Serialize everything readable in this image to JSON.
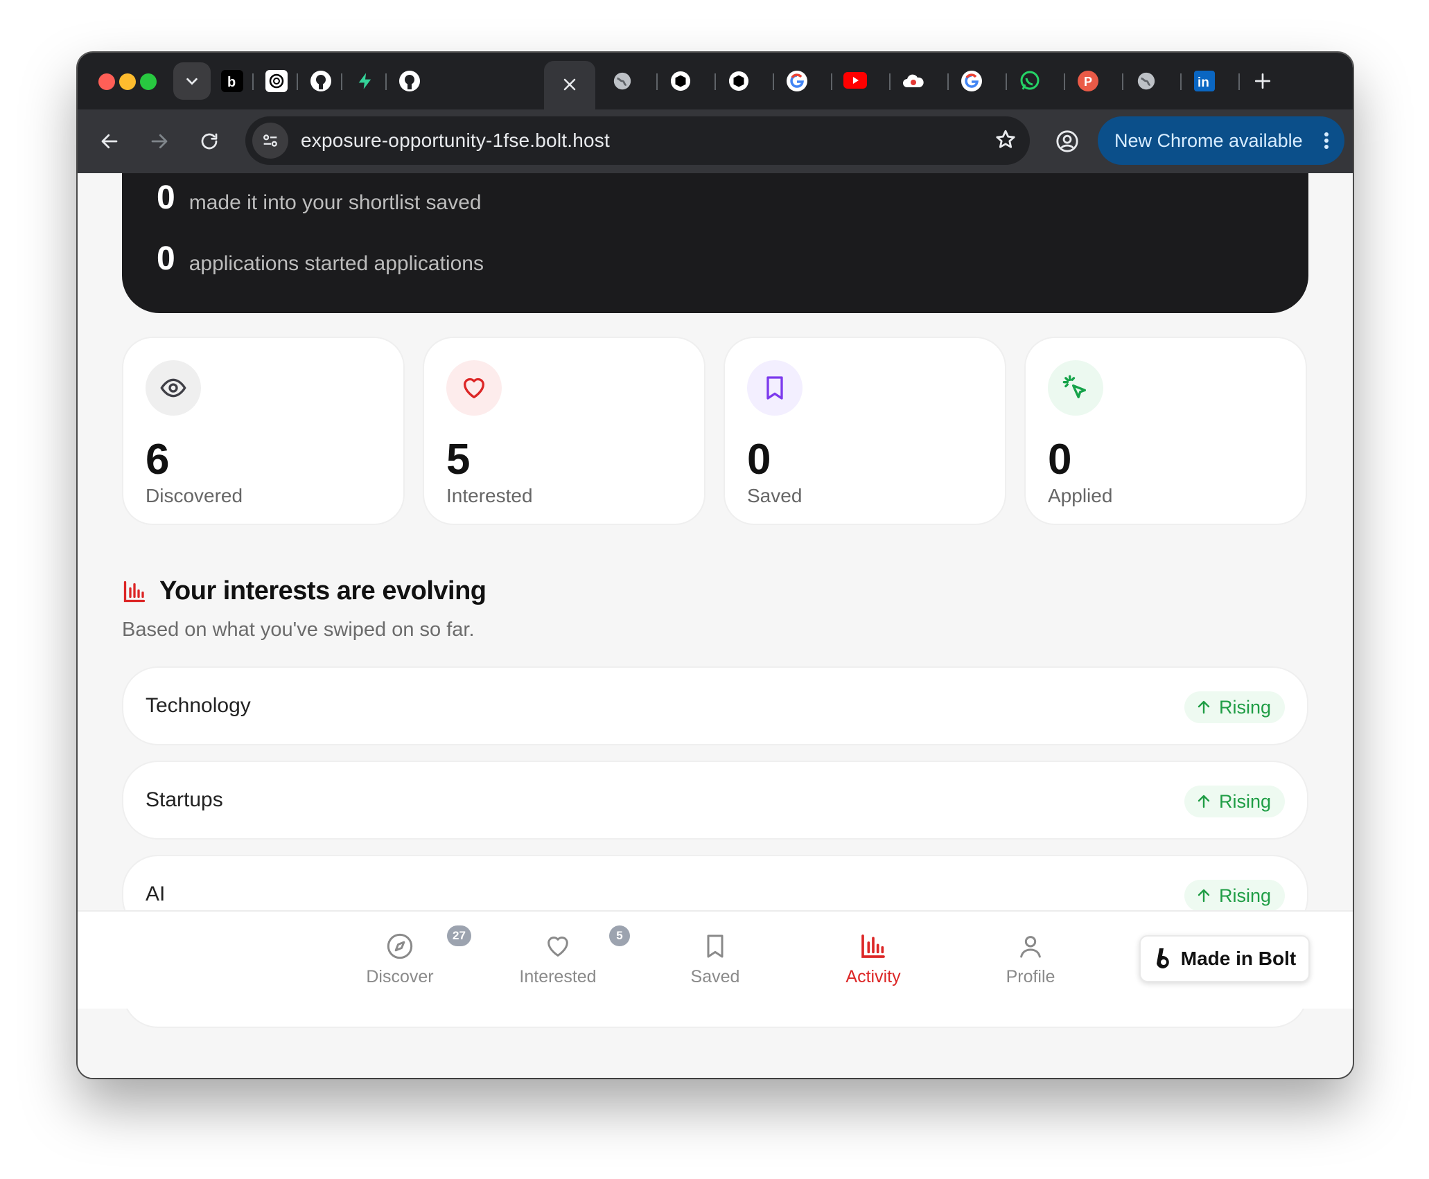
{
  "browser": {
    "url": "exposure-opportunity-1fse.bolt.host",
    "update_button": "New Chrome available",
    "tabs": [
      "bolt-icon",
      "openai-icon",
      "github-icon",
      "bolt-green-icon",
      "github-icon",
      "close-icon",
      "globe-icon",
      "cube-icon",
      "cube-icon",
      "google-icon",
      "youtube-icon",
      "cloud-icon",
      "google-icon",
      "whatsapp-icon",
      "producthunt-icon",
      "globe-icon",
      "linkedin-icon"
    ]
  },
  "hero": {
    "rows": [
      {
        "value": "0",
        "label": "made it into your shortlist saved"
      },
      {
        "value": "0",
        "label": "applications started applications"
      }
    ]
  },
  "stats": [
    {
      "value": "6",
      "label": "Discovered",
      "icon": "eye-icon",
      "color": "#3f3f46"
    },
    {
      "value": "5",
      "label": "Interested",
      "icon": "heart-icon",
      "color": "#dc2626"
    },
    {
      "value": "0",
      "label": "Saved",
      "icon": "bookmark-icon",
      "color": "#7c3aed"
    },
    {
      "value": "0",
      "label": "Applied",
      "icon": "cursor-click-icon",
      "color": "#16a34a"
    }
  ],
  "interests": {
    "title": "Your interests are evolving",
    "subtitle": "Based on what you've swiped on so far.",
    "items": [
      {
        "name": "Technology",
        "trend": "Rising"
      },
      {
        "name": "Startups",
        "trend": "Rising"
      },
      {
        "name": "AI",
        "trend": "Rising"
      }
    ]
  },
  "nav": {
    "items": [
      {
        "label": "Discover",
        "badge": "27"
      },
      {
        "label": "Interested",
        "badge": "5"
      },
      {
        "label": "Saved"
      },
      {
        "label": "Activity"
      },
      {
        "label": "Profile"
      }
    ],
    "active": "Activity",
    "made_in": "Made in Bolt"
  }
}
